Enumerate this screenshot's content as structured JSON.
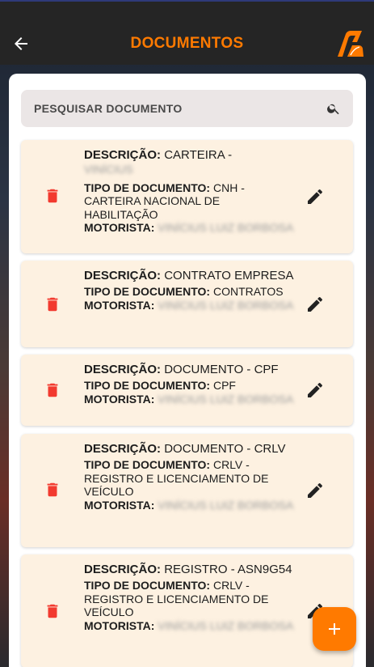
{
  "header": {
    "title": "DOCUMENTOS"
  },
  "search": {
    "placeholder": "PESQUISAR DOCUMENTO"
  },
  "labels": {
    "descricao": "DESCRIÇÃO:",
    "tipo": "TIPO DE DOCUMENTO:",
    "motorista": "MOTORISTA:"
  },
  "cards": [
    {
      "descricao": "CARTEIRA -",
      "descricao_blurred": "VINÍCIUS",
      "tipo": "CNH - CARTEIRA NACIONAL DE HABILITAÇÃO",
      "motorista_blurred": "VINÍCIUS LUIZ BORBOSA"
    },
    {
      "descricao": "CONTRATO EMPRESA",
      "tipo": "CONTRATOS",
      "motorista_blurred": "VINÍCIUS LUIZ BORBOSA"
    },
    {
      "descricao": "DOCUMENTO - CPF",
      "tipo": "CPF",
      "motorista_blurred": "VINÍCIUS LUIZ BORBOSA"
    },
    {
      "descricao": "DOCUMENTO - CRLV",
      "tipo": "CRLV - REGISTRO E LICENCIAMENTO DE VEÍCULO",
      "motorista_blurred": "VINÍCIUS LUIZ BORBOSA"
    },
    {
      "descricao": "REGISTRO - ASN9G54",
      "tipo": "CRLV - REGISTRO E LICENCIAMENTO DE VEÍCULO",
      "motorista_blurred": "VINÍCIUS LUIZ BORBOSA"
    }
  ],
  "colors": {
    "accent": "#ff7a00",
    "delete": "#f23a2f",
    "card": "#fdf1e1",
    "appbar": "#252525"
  },
  "icons": {
    "back": "arrow-left-icon",
    "search": "search-icon",
    "delete": "trash-icon",
    "edit": "pencil-icon",
    "add": "plus-icon"
  }
}
